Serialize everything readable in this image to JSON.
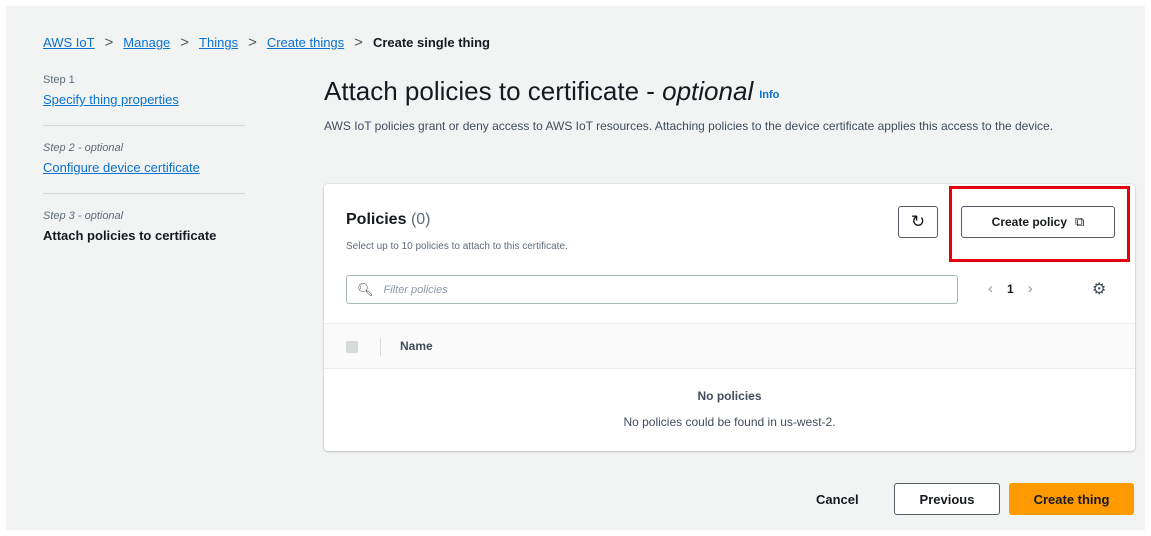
{
  "breadcrumb": {
    "items": [
      "AWS IoT",
      "Manage",
      "Things",
      "Create things"
    ],
    "current": "Create single thing",
    "separator": ">"
  },
  "steps": [
    {
      "label": "Step 1",
      "title": "Specify thing properties"
    },
    {
      "label": "Step 2 - optional",
      "title": "Configure device certificate"
    },
    {
      "label": "Step 3 - optional",
      "title": "Attach policies to certificate"
    }
  ],
  "header": {
    "title": "Attach policies to certificate - ",
    "title_optional": "optional",
    "info": "Info",
    "description": "AWS IoT policies grant or deny access to AWS IoT resources. Attaching policies to the device certificate applies this access to the device."
  },
  "policies": {
    "title": "Policies",
    "count": "(0)",
    "description": "Select up to 10 policies to attach to this certificate.",
    "refresh_icon": "refresh-icon",
    "create_policy_label": "Create policy",
    "external_icon": "external-link-icon",
    "filter_placeholder": "Filter policies",
    "filter_value": "",
    "page": "1",
    "column_name": "Name",
    "empty_title": "No policies",
    "empty_desc": "No policies could be found in us-west-2."
  },
  "footer": {
    "cancel": "Cancel",
    "previous": "Previous",
    "create_thing": "Create thing"
  },
  "colors": {
    "link": "#0972d3",
    "primary_button": "#ff9900",
    "highlight": "#e3000f",
    "background": "#f2f3f3"
  }
}
